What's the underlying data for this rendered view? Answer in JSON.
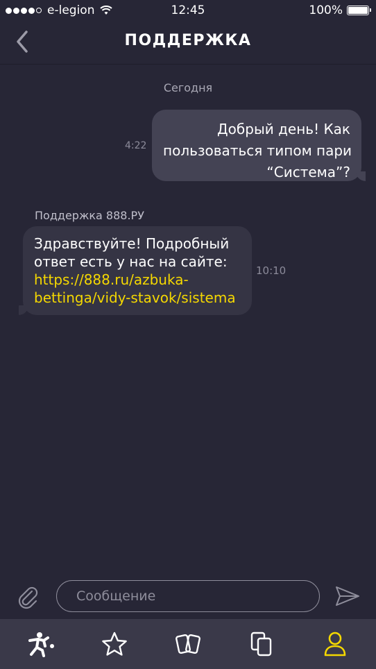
{
  "status_bar": {
    "carrier": "e-legion",
    "time": "12:45",
    "battery": "100%"
  },
  "nav": {
    "title": "ПОДДЕРЖКА"
  },
  "chat": {
    "date_separator": "Сегодня",
    "outgoing": {
      "lines": [
        "Добрый день! Как",
        "пользоваться типом пари",
        "“Система”?"
      ],
      "time": "4:22"
    },
    "incoming": {
      "sender": "Поддержка 888.РУ",
      "lines": [
        "Здравствуйте! Подробный",
        "ответ есть у нас на сайте:"
      ],
      "link_lines": [
        "https://888.ru/azbuka-",
        "bettinga/vidy-stavok/sistema"
      ],
      "time": "10:10"
    }
  },
  "composer": {
    "placeholder": "Сообщение"
  },
  "tabs": [
    {
      "icon": "football-player-icon",
      "active": false
    },
    {
      "icon": "star-icon",
      "active": false
    },
    {
      "icon": "cards-icon",
      "active": false
    },
    {
      "icon": "copy-documents-icon",
      "active": false
    },
    {
      "icon": "profile-icon",
      "active": true
    }
  ],
  "colors": {
    "background": "#272636",
    "accent": "#f5d800",
    "bubble_outgoing": "#444354",
    "bubble_incoming": "#353444",
    "tab_bar": "#3a3949"
  }
}
